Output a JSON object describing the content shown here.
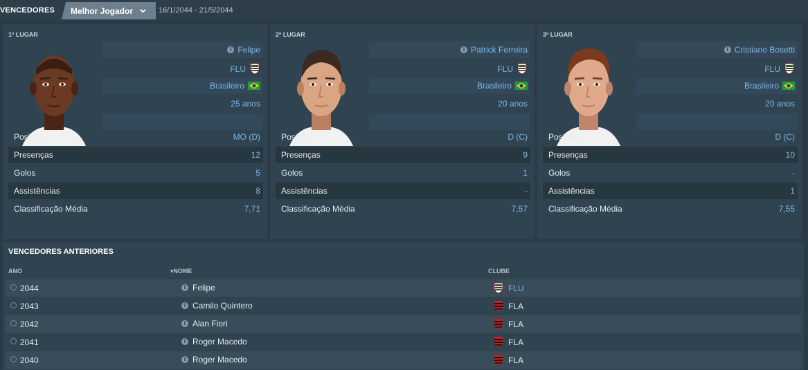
{
  "header": {
    "title": "VENCEDORES",
    "award": "Melhor Jogador",
    "period": "16/1/2044 - 21/5/2044"
  },
  "podium": [
    {
      "place": "1º LUGAR",
      "name": "Felipe",
      "club": "FLU",
      "nationality": "Brasileiro",
      "age": "25 anos",
      "stats": [
        {
          "label": "Posição",
          "value": "MO (D)"
        },
        {
          "label": "Presenças",
          "value": "12"
        },
        {
          "label": "Golos",
          "value": "5"
        },
        {
          "label": "Assistências",
          "value": "8"
        },
        {
          "label": "Classificação Média",
          "value": "7,71"
        }
      ]
    },
    {
      "place": "2º LUGAR",
      "name": "Patrick Ferreira",
      "club": "FLU",
      "nationality": "Brasileiro",
      "age": "20 anos",
      "stats": [
        {
          "label": "Posição",
          "value": "D (C)"
        },
        {
          "label": "Presenças",
          "value": "9"
        },
        {
          "label": "Golos",
          "value": "1"
        },
        {
          "label": "Assistências",
          "value": "-"
        },
        {
          "label": "Classificação Média",
          "value": "7,57"
        }
      ]
    },
    {
      "place": "3º LUGAR",
      "name": "Cristiano Bosetti",
      "club": "FLU",
      "nationality": "Brasileiro",
      "age": "20 anos",
      "stats": [
        {
          "label": "Posição",
          "value": "D (C)"
        },
        {
          "label": "Presenças",
          "value": "10"
        },
        {
          "label": "Golos",
          "value": "-"
        },
        {
          "label": "Assistências",
          "value": "1"
        },
        {
          "label": "Classificação Média",
          "value": "7,55"
        }
      ]
    }
  ],
  "previous": {
    "heading": "VENCEDORES ANTERIORES",
    "columns": {
      "year": "ANO",
      "name": "NOME",
      "club": "CLUBE"
    },
    "rows": [
      {
        "year": "2044",
        "name": "Felipe",
        "club": "FLU"
      },
      {
        "year": "2043",
        "name": "Camilo Quintero",
        "club": "FLA"
      },
      {
        "year": "2042",
        "name": "Alan Fiori",
        "club": "FLA"
      },
      {
        "year": "2041",
        "name": "Roger Macedo",
        "club": "FLA"
      },
      {
        "year": "2040",
        "name": "Roger Macedo",
        "club": "FLA"
      }
    ]
  },
  "colors": {
    "accent": "#7db6e6",
    "panel": "#2f4350",
    "background": "#2a3a46"
  }
}
